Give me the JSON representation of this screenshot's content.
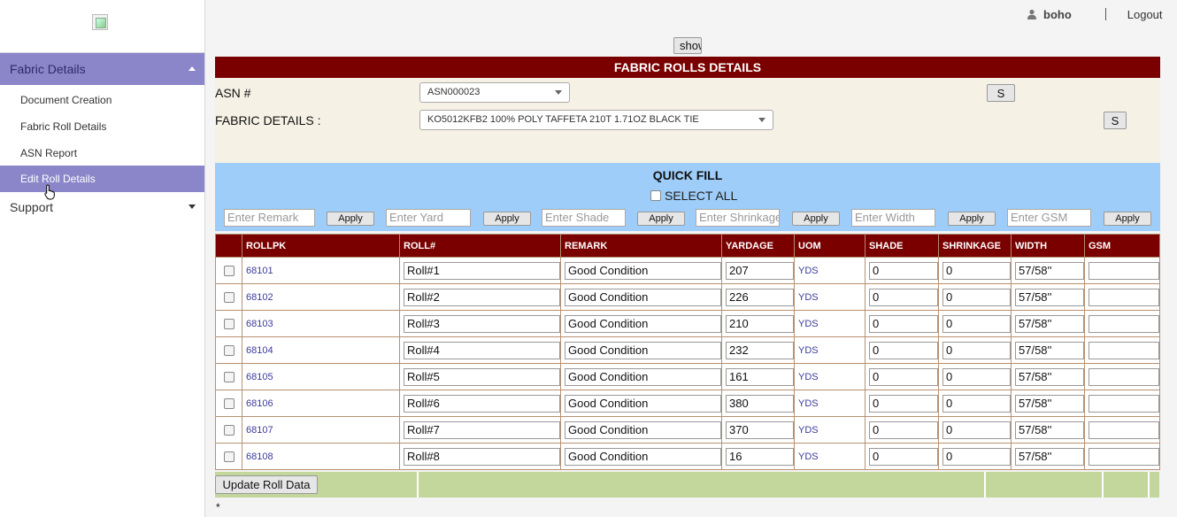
{
  "sidebar": {
    "section_fabric": "Fabric Details",
    "items": [
      {
        "label": "Document Creation"
      },
      {
        "label": "Fabric Roll Details"
      },
      {
        "label": "ASN Report"
      },
      {
        "label": "Edit Roll Details"
      }
    ],
    "section_support": "Support"
  },
  "topbar": {
    "user_name": "boho",
    "logout": "Logout",
    "show_button": "show"
  },
  "details": {
    "title": "FABRIC ROLLS DETAILS",
    "asn_label": "ASN #",
    "asn_value": "ASN000023",
    "fabric_label": "FABRIC DETAILS :",
    "fabric_value": "KO5012KFB2 100% POLY TAFFETA 210T 1.71OZ BLACK TIE",
    "s_button": "S"
  },
  "quick_fill": {
    "title": "QUICK FILL",
    "select_all": "SELECT ALL",
    "apply": "Apply",
    "placeholders": {
      "remark": "Enter Remark",
      "yard": "Enter Yard",
      "shade": "Enter Shade",
      "shrinkage": "Enter Shrinkage",
      "width": "Enter Width",
      "gsm": "Enter GSM"
    }
  },
  "table": {
    "headers": {
      "rollpk": "ROLLPK",
      "roll": "ROLL#",
      "remark": "REMARK",
      "yardage": "YARDAGE",
      "uom": "UOM",
      "shade": "SHADE",
      "shrinkage": "SHRINKAGE",
      "width": "WIDTH",
      "gsm": "GSM"
    },
    "rows": [
      {
        "rollpk": "68101",
        "roll": "Roll#1",
        "remark": "Good Condition",
        "yardage": "207",
        "uom": "YDS",
        "shade": "0",
        "shrinkage": "0",
        "width": "57/58''",
        "gsm": ""
      },
      {
        "rollpk": "68102",
        "roll": "Roll#2",
        "remark": "Good Condition",
        "yardage": "226",
        "uom": "YDS",
        "shade": "0",
        "shrinkage": "0",
        "width": "57/58''",
        "gsm": ""
      },
      {
        "rollpk": "68103",
        "roll": "Roll#3",
        "remark": "Good Condition",
        "yardage": "210",
        "uom": "YDS",
        "shade": "0",
        "shrinkage": "0",
        "width": "57/58''",
        "gsm": ""
      },
      {
        "rollpk": "68104",
        "roll": "Roll#4",
        "remark": "Good Condition",
        "yardage": "232",
        "uom": "YDS",
        "shade": "0",
        "shrinkage": "0",
        "width": "57/58''",
        "gsm": ""
      },
      {
        "rollpk": "68105",
        "roll": "Roll#5",
        "remark": "Good Condition",
        "yardage": "161",
        "uom": "YDS",
        "shade": "0",
        "shrinkage": "0",
        "width": "57/58''",
        "gsm": ""
      },
      {
        "rollpk": "68106",
        "roll": "Roll#6",
        "remark": "Good Condition",
        "yardage": "380",
        "uom": "YDS",
        "shade": "0",
        "shrinkage": "0",
        "width": "57/58''",
        "gsm": ""
      },
      {
        "rollpk": "68107",
        "roll": "Roll#7",
        "remark": "Good Condition",
        "yardage": "370",
        "uom": "YDS",
        "shade": "0",
        "shrinkage": "0",
        "width": "57/58''",
        "gsm": ""
      },
      {
        "rollpk": "68108",
        "roll": "Roll#8",
        "remark": "Good Condition",
        "yardage": "16",
        "uom": "YDS",
        "shade": "0",
        "shrinkage": "0",
        "width": "57/58''",
        "gsm": ""
      }
    ]
  },
  "footer": {
    "update_button": "Update Roll Data",
    "asterisk": "*"
  },
  "colors": {
    "header_maroon": "#7a0000",
    "sidebar_active": "#8b86c9",
    "quick_fill_bg": "#9dcdf8",
    "footer_green": "#c3d69b",
    "panel_cream": "#f5f1e4"
  }
}
